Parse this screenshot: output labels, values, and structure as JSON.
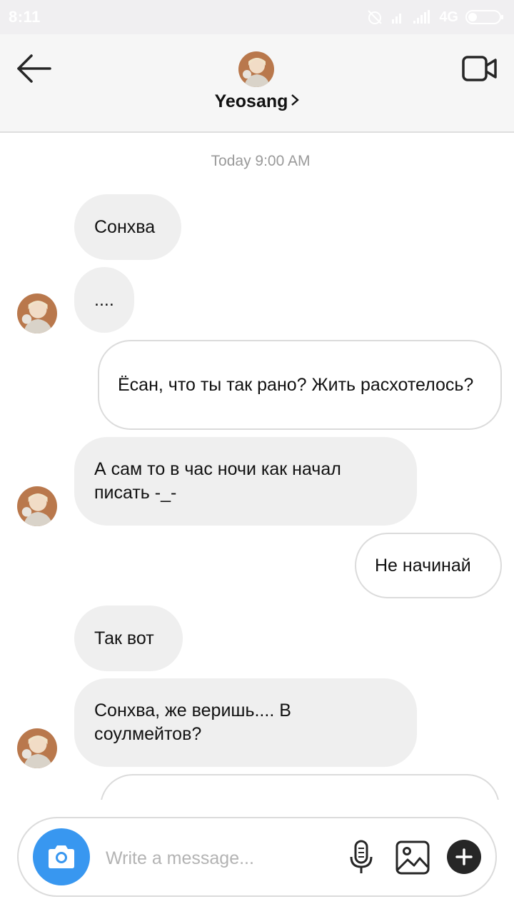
{
  "status_bar": {
    "time": "8:11",
    "network": "4G"
  },
  "header": {
    "contact_name": "Yeosang",
    "chevron": "›"
  },
  "chat": {
    "timestamp": "Today 9:00 AM",
    "messages": [
      {
        "from": "contact",
        "text": "Сонхва"
      },
      {
        "from": "contact",
        "text": "...."
      },
      {
        "from": "me",
        "text": "Ёсан, что ты так рано? Жить расхотелось?"
      },
      {
        "from": "contact",
        "text": "А сам то в час ночи как начал писать -_-"
      },
      {
        "from": "me",
        "text": "Не начинай"
      },
      {
        "from": "contact",
        "text": "Так вот"
      },
      {
        "from": "contact",
        "text": "Сонхва, же веришь.... В соулмейтов?"
      },
      {
        "from": "me",
        "text": ""
      }
    ]
  },
  "composer": {
    "placeholder": "Write a message..."
  },
  "icons": {
    "back": "arrow-left-icon",
    "video": "video-camera-icon",
    "camera": "camera-icon",
    "mic": "microphone-icon",
    "gallery": "image-icon",
    "plus": "plus-icon"
  },
  "colors": {
    "accent": "#3897f0",
    "incoming_bubble": "#efefef",
    "outgoing_border": "#dbdbdb"
  }
}
